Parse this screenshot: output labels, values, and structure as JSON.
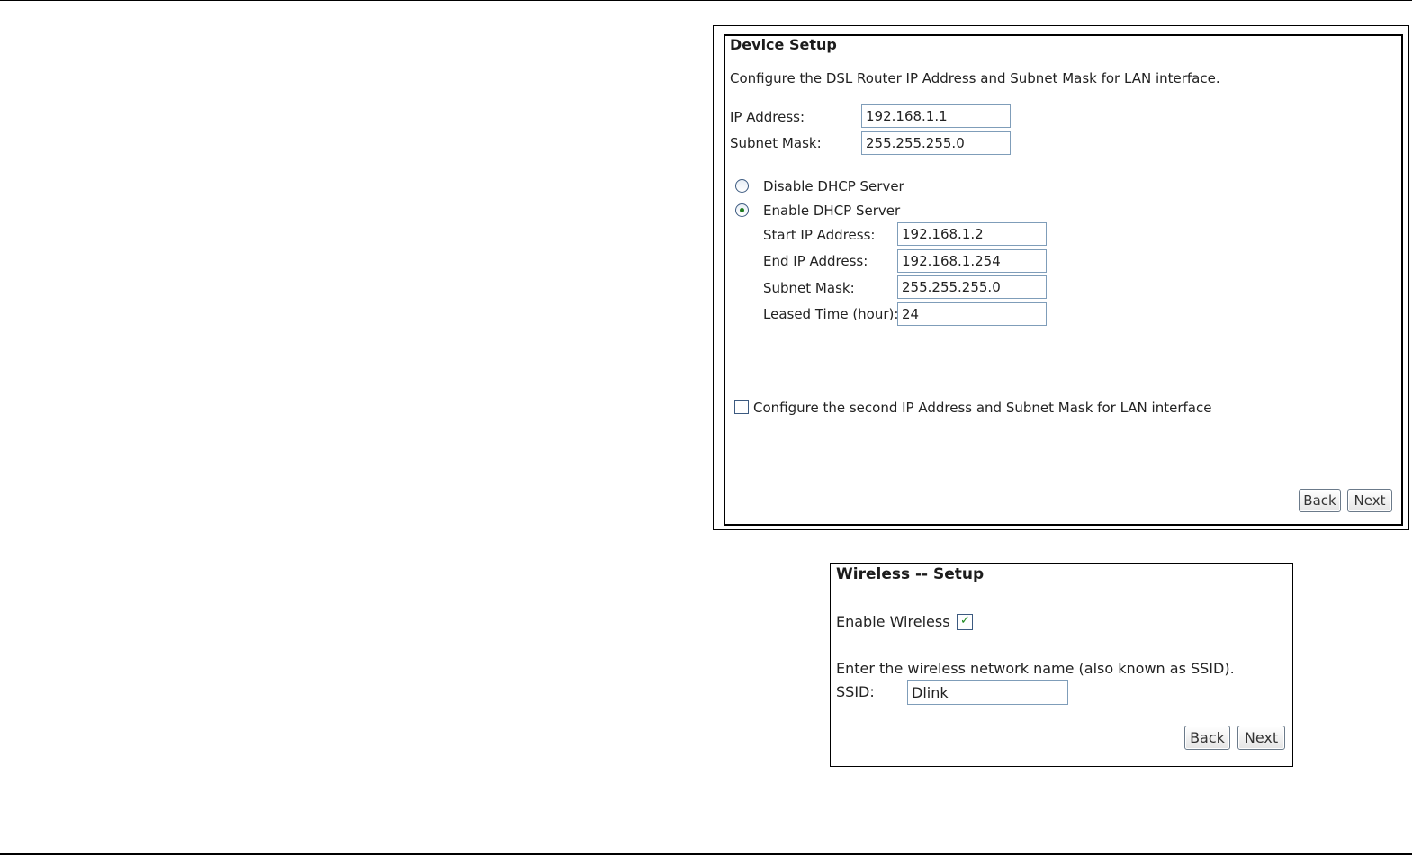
{
  "device_setup": {
    "title": "Device Setup",
    "description": "Configure the DSL Router IP Address and Subnet Mask for LAN interface.",
    "ip_address_label": "IP Address:",
    "ip_address_value": "192.168.1.1",
    "subnet_mask_label": "Subnet Mask:",
    "subnet_mask_value": "255.255.255.0",
    "dhcp": {
      "disable_label": "Disable DHCP Server",
      "enable_label": "Enable DHCP Server",
      "selected": "enable",
      "start_ip_label": "Start IP Address:",
      "start_ip_value": "192.168.1.2",
      "end_ip_label": "End IP Address:",
      "end_ip_value": "192.168.1.254",
      "subnet_mask_label": "Subnet Mask:",
      "subnet_mask_value": "255.255.255.0",
      "leased_time_label": "Leased Time (hour):",
      "leased_time_value": "24"
    },
    "second_ip_label": "Configure the second IP Address and Subnet Mask for LAN interface",
    "second_ip_checked": false,
    "back_label": "Back",
    "next_label": "Next"
  },
  "wireless_setup": {
    "title": "Wireless -- Setup",
    "enable_label": "Enable Wireless",
    "enable_checked": true,
    "ssid_prompt": "Enter the wireless network name (also known as SSID).",
    "ssid_label": "SSID:",
    "ssid_value": "Dlink",
    "back_label": "Back",
    "next_label": "Next"
  },
  "colors": {
    "field_border": "#7f9db9",
    "radio_selected_dot": "#1e7a1e",
    "checkmark": "#1e8a1e"
  },
  "icons": {
    "radio_selected": "radio-selected-icon",
    "checkmark": "checkmark-icon"
  }
}
